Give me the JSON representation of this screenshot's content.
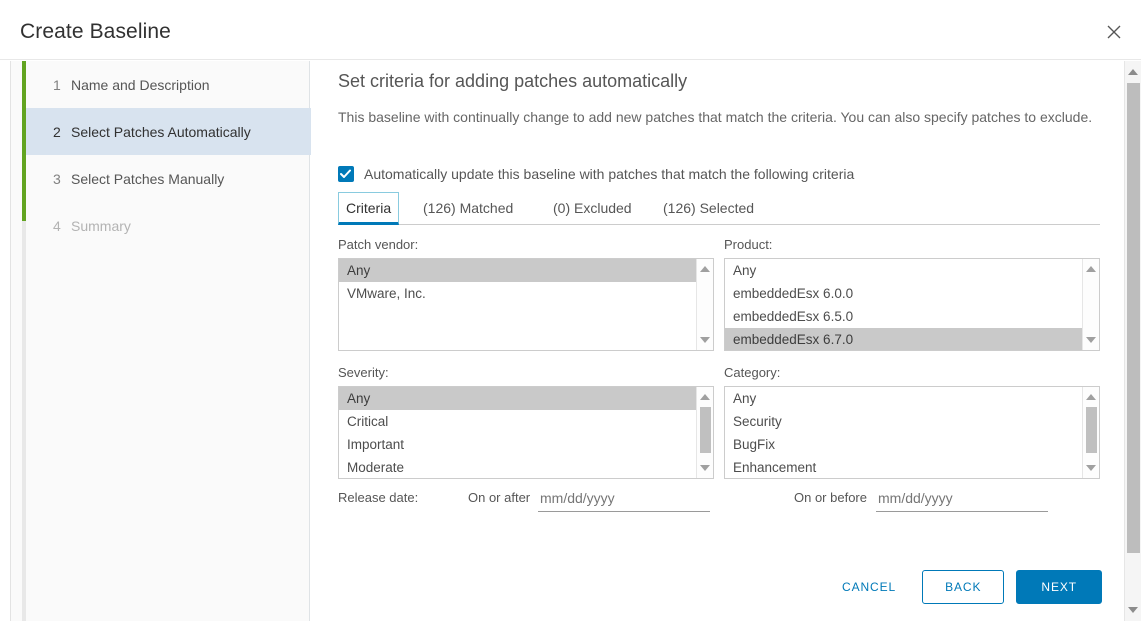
{
  "dialog": {
    "title": "Create Baseline",
    "close_icon": "close-icon"
  },
  "wizard": {
    "steps": [
      {
        "num": "1",
        "label": "Name and Description",
        "state": "complete"
      },
      {
        "num": "2",
        "label": "Select Patches Automatically",
        "state": "active"
      },
      {
        "num": "3",
        "label": "Select Patches Manually",
        "state": "enabled"
      },
      {
        "num": "4",
        "label": "Summary",
        "state": "disabled"
      }
    ],
    "progress_color": "#62a420",
    "active_color": "#d8e3ef"
  },
  "main": {
    "title": "Set criteria for adding patches automatically",
    "description": "This baseline with continually change to add new patches that match the criteria. You can also specify patches to exclude.",
    "auto_update": {
      "label": "Automatically update this baseline with patches that match the following criteria",
      "checked": true,
      "accent": "#0079b8"
    },
    "tabs": [
      {
        "label": "Criteria",
        "active": true
      },
      {
        "label": "(126) Matched",
        "active": false
      },
      {
        "label": "(0) Excluded",
        "active": false
      },
      {
        "label": "(126) Selected",
        "active": false
      }
    ],
    "fields": {
      "patch_vendor": {
        "label": "Patch vendor:",
        "options": [
          "Any",
          "VMware, Inc."
        ],
        "selected": [
          "Any"
        ],
        "scroll": {
          "thumb_top_pct": 0,
          "thumb_height_pct": 0,
          "thumb_visible": false
        }
      },
      "product": {
        "label": "Product:",
        "options": [
          "Any",
          "embeddedEsx 6.0.0",
          "embeddedEsx 6.5.0",
          "embeddedEsx 6.7.0"
        ],
        "selected": [
          "embeddedEsx 6.7.0"
        ],
        "scroll": {
          "thumb_top_pct": 0,
          "thumb_height_pct": 0,
          "thumb_visible": false
        }
      },
      "severity": {
        "label": "Severity:",
        "options": [
          "Any",
          "Critical",
          "Important",
          "Moderate"
        ],
        "selected": [
          "Any"
        ],
        "scroll": {
          "thumb_top_pct": 2,
          "thumb_height_pct": 62,
          "thumb_visible": true
        }
      },
      "category": {
        "label": "Category:",
        "options": [
          "Any",
          "Security",
          "BugFix",
          "Enhancement"
        ],
        "selected": [],
        "scroll": {
          "thumb_top_pct": 2,
          "thumb_height_pct": 62,
          "thumb_visible": true
        }
      }
    },
    "release_date": {
      "label": "Release date:",
      "on_or_after_label": "On or after",
      "on_or_after_value": "",
      "on_or_after_placeholder": "mm/dd/yyyy",
      "on_or_before_label": "On or before",
      "on_or_before_value": "",
      "on_or_before_placeholder": "mm/dd/yyyy"
    }
  },
  "footer": {
    "cancel": "CANCEL",
    "back": "BACK",
    "next": "NEXT"
  }
}
